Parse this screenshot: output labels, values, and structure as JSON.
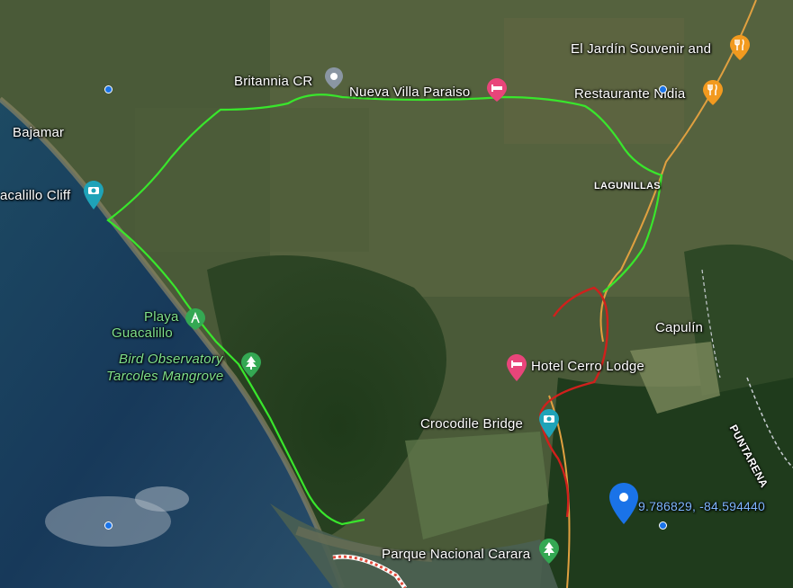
{
  "labels": {
    "britannia": "Britannia CR",
    "nueva_villa": "Nueva Villa Paraiso",
    "el_jardin": "El Jardín Souvenir and",
    "restaurante": "Restaurante Nidia",
    "bajamar": "Bajamar",
    "guacalillo_cliff": "acalillo Cliff",
    "lagunillas": "LAGUNILLAS",
    "playa_line1": "Playa",
    "playa_line2": "Guacalillo",
    "bird_line1": "Bird Observatory",
    "bird_line2": "Tarcoles Mangrove",
    "capulin": "Capulín",
    "hotel_cerro": "Hotel Cerro Lodge",
    "crocodile": "Crocodile Bridge",
    "puntarenas": "PUNTARENA",
    "parque": "Parque Nacional Carara",
    "coordinates": "9.786829, -84.594440"
  },
  "icons": {
    "britannia": "location-pin-icon",
    "nueva_villa": "hotel-icon",
    "el_jardin": "restaurant-icon",
    "restaurante": "restaurant-icon",
    "guacalillo_cliff": "camera-icon",
    "playa": "hiking-icon",
    "bird": "tree-icon",
    "hotel_cerro": "hotel-icon",
    "crocodile": "camera-icon",
    "parque": "tree-icon",
    "dropped_pin": "dropped-pin-icon"
  },
  "colors": {
    "route_green": "#39e62c",
    "route_red": "#d0201c",
    "road_orange": "#e0a040",
    "hotel_pink": "#e8457a",
    "restaurant_orange": "#f29a1f",
    "photo_teal": "#1fa3b8",
    "park_green": "#34a853",
    "pin_blue": "#1a73e8",
    "pin_gray": "#8a96a3"
  }
}
